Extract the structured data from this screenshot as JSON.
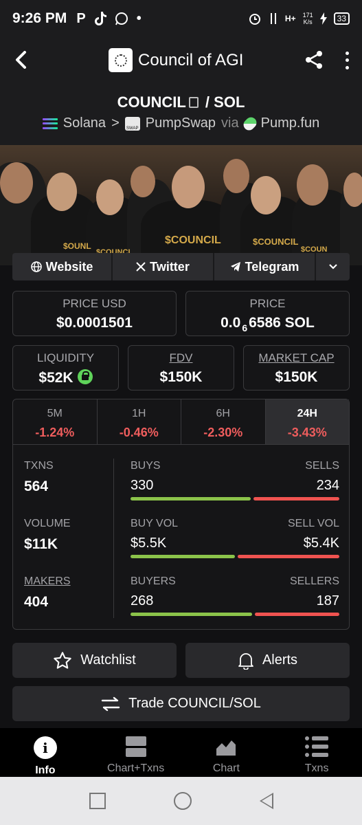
{
  "status_bar": {
    "time": "9:26 PM",
    "app_icons": [
      "P",
      "tiktok-icon",
      "whatsapp-icon",
      "•"
    ],
    "net_speed_value": "171",
    "net_speed_unit": "K/s",
    "network": "H+",
    "battery": "33"
  },
  "header": {
    "title": "Council of AGI",
    "back_icon": "chevron-left-icon",
    "share_icon": "share-icon",
    "menu_icon": "kebab-menu-icon"
  },
  "pair": {
    "base": "COUNCIL",
    "separator": "/",
    "quote": "SOL",
    "chain": "Solana",
    "chevron": ">",
    "dex": "PumpSwap",
    "via": "via",
    "launchpad": "Pump.fun"
  },
  "links": {
    "website": "Website",
    "twitter": "Twitter",
    "telegram": "Telegram"
  },
  "stats": {
    "price_usd_label": "PRICE USD",
    "price_usd": "$0.0001501",
    "price_label": "PRICE",
    "price_sol_prefix": "0.0",
    "price_sol_zeros": "6",
    "price_sol_rest": "6586 SOL",
    "liquidity_label": "LIQUIDITY",
    "liquidity": "$52K",
    "fdv_label": "FDV",
    "fdv": "$150K",
    "mcap_label": "MARKET CAP",
    "mcap": "$150K"
  },
  "timeframes": [
    {
      "label": "5M",
      "change": "-1.24%"
    },
    {
      "label": "1H",
      "change": "-0.46%"
    },
    {
      "label": "6H",
      "change": "-2.30%"
    },
    {
      "label": "24H",
      "change": "-3.43%"
    }
  ],
  "activity": {
    "txns_label": "TXNS",
    "txns": "564",
    "volume_label": "VOLUME",
    "volume": "$11K",
    "makers_label": "MAKERS",
    "makers": "404",
    "buys_label": "BUYS",
    "buys": "330",
    "sells_label": "SELLS",
    "sells": "234",
    "buy_vol_label": "BUY VOL",
    "buy_vol": "$5.5K",
    "sell_vol_label": "SELL VOL",
    "sell_vol": "$5.4K",
    "buyers_label": "BUYERS",
    "buyers": "268",
    "sellers_label": "SELLERS",
    "sellers": "187",
    "buys_ratio": 0.585,
    "buy_vol_ratio": 0.505,
    "buyers_ratio": 0.589
  },
  "actions": {
    "watchlist": "Watchlist",
    "alerts": "Alerts",
    "trade": "Trade COUNCIL/SOL"
  },
  "bottom_nav": {
    "info": "Info",
    "chart_txns": "Chart+Txns",
    "chart": "Chart",
    "txns": "Txns"
  },
  "banner_text": {
    "shirt_center": "$COUNCIL",
    "shirt_left": "$OUNL",
    "shirt_mid": "$COUNCI",
    "shirt_right": "$COUNCIL",
    "shirt_far_right": "$COUN"
  },
  "colors": {
    "negative": "#ef5d5d",
    "buy_bar": "#8bc34a",
    "sell_bar": "#ef5350",
    "lock": "#5fd35a"
  }
}
